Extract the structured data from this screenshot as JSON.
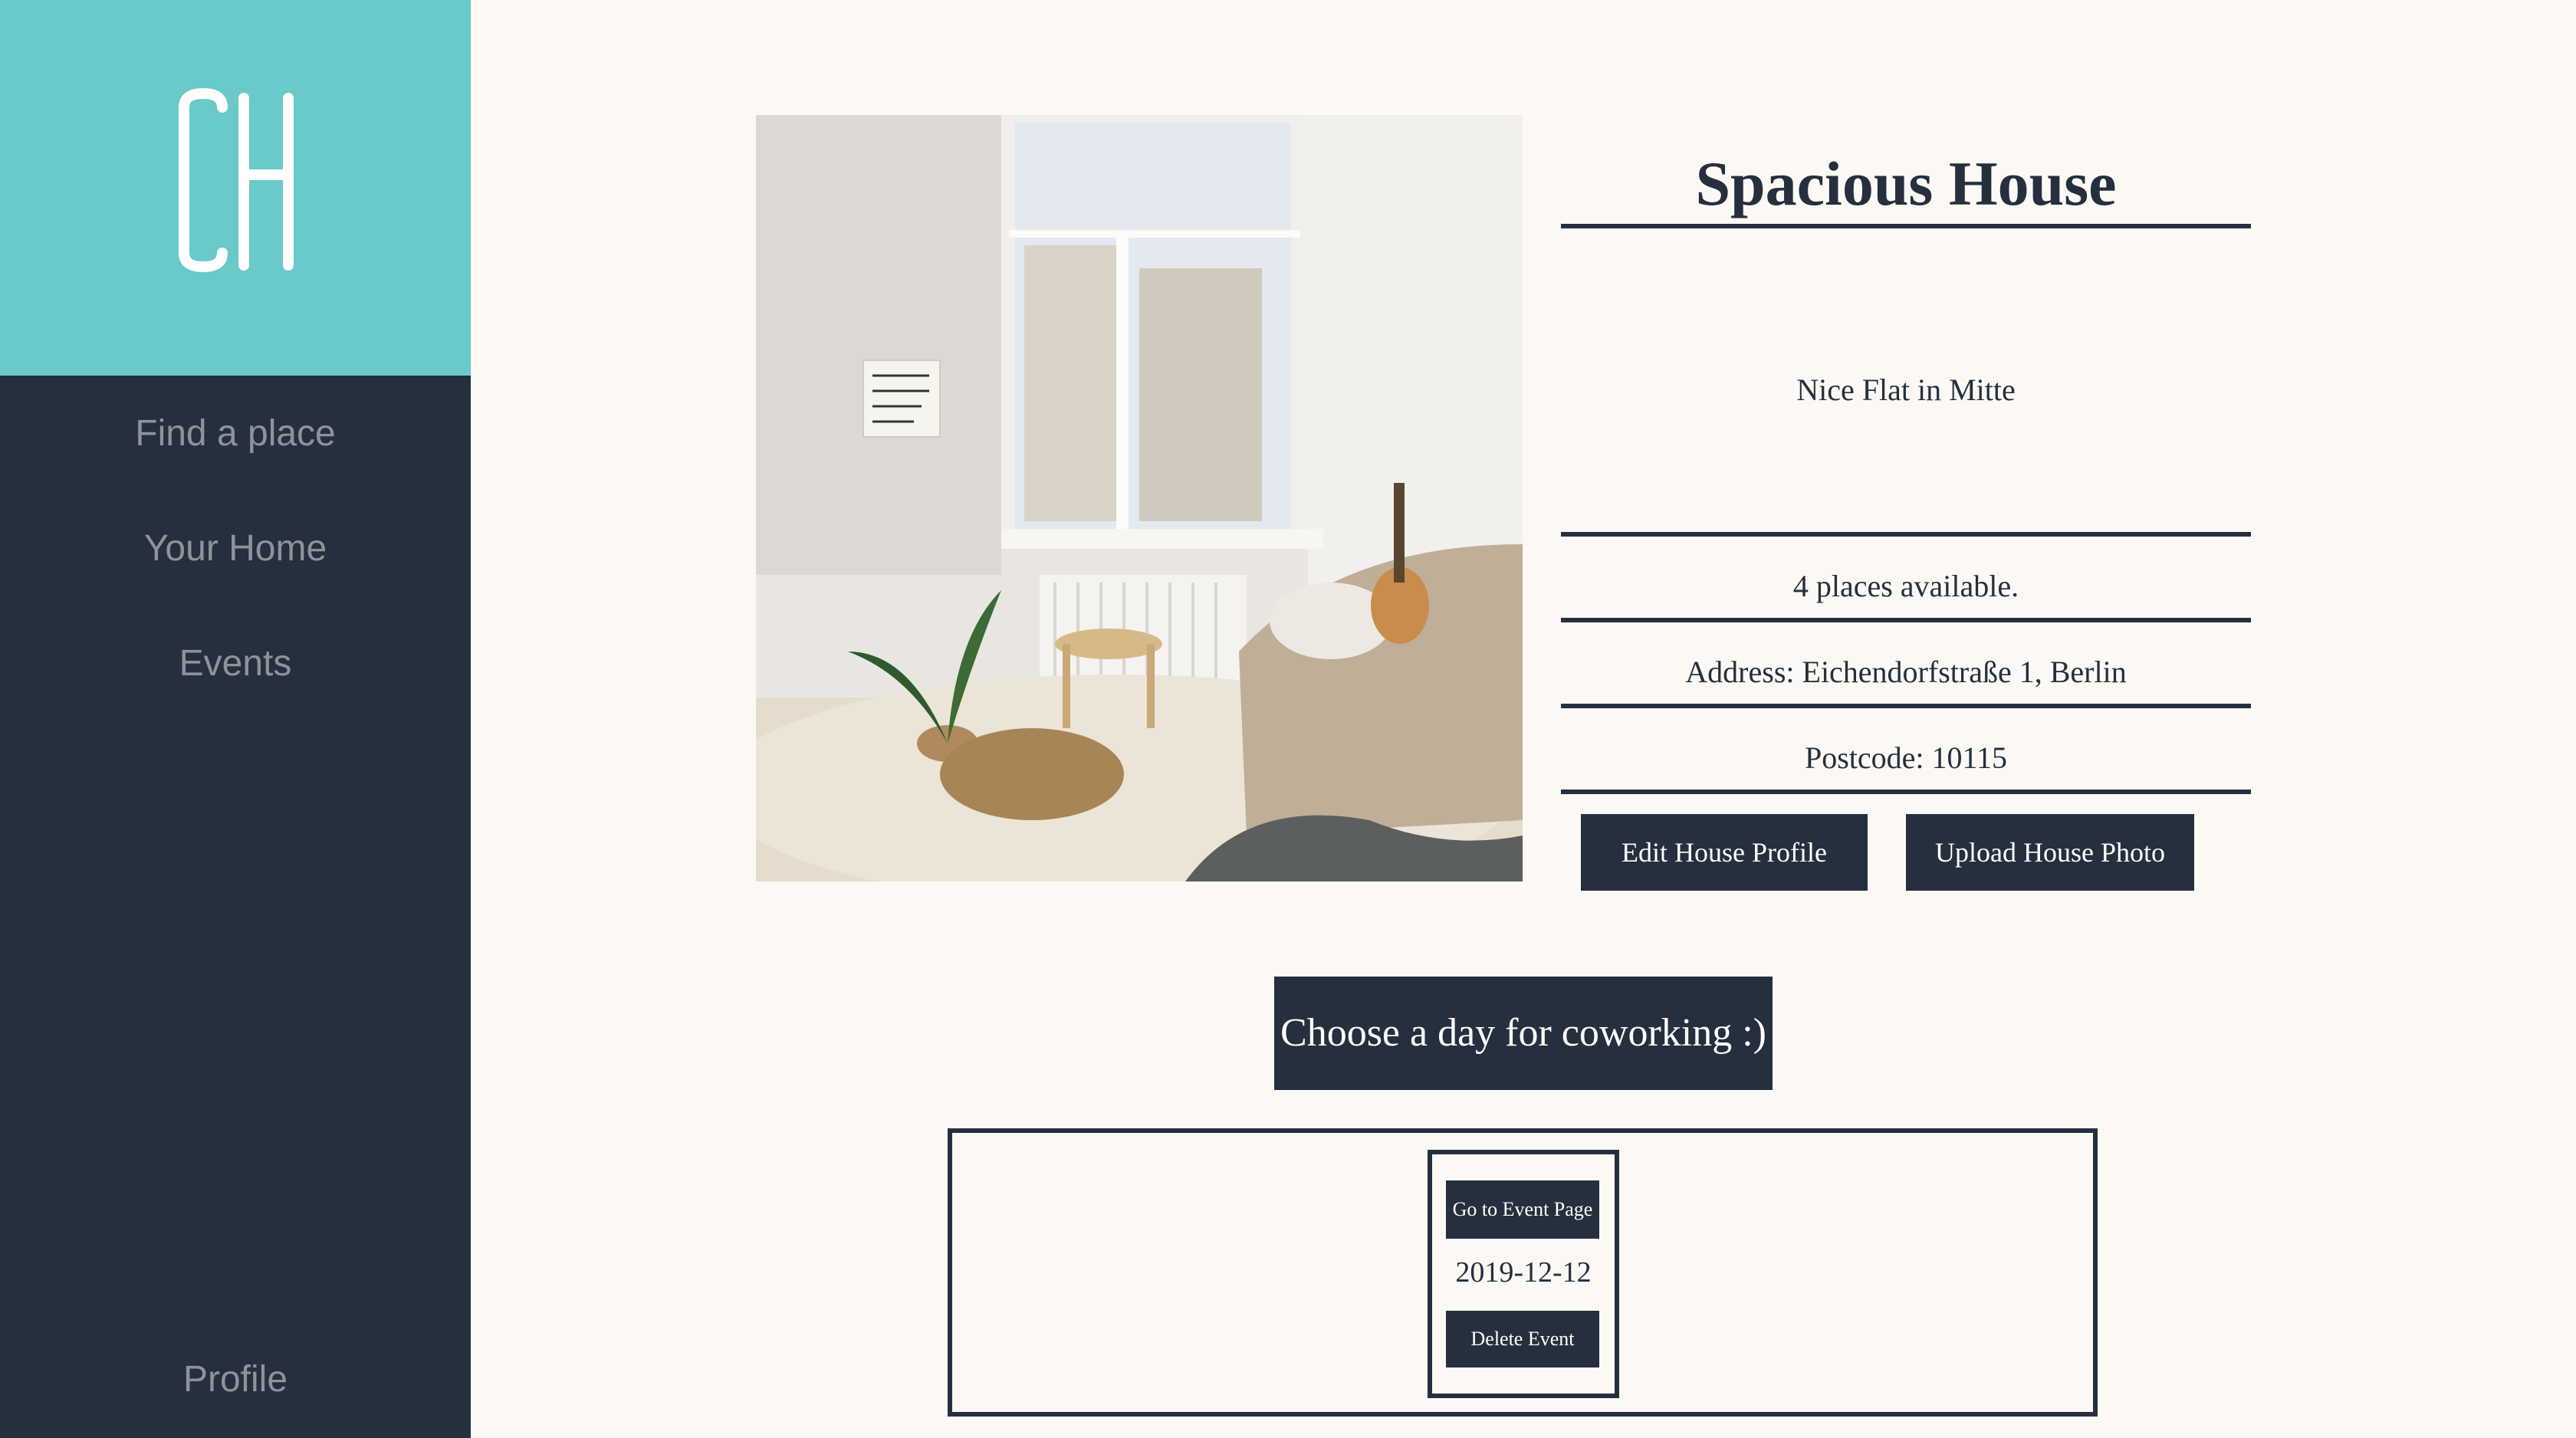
{
  "sidebar": {
    "logo_text": "CH",
    "nav": {
      "find_a_place": "Find a place",
      "your_home": "Your Home",
      "events": "Events",
      "profile": "Profile"
    }
  },
  "house": {
    "title": "Spacious House",
    "description": "Nice Flat in Mitte",
    "places": "4 places available.",
    "address": "Address: Eichendorfstraße 1, Berlin",
    "postcode": "Postcode: 10115",
    "edit_label": "Edit House Profile",
    "upload_label": "Upload House Photo"
  },
  "coworking": {
    "choose_label": "Choose a day for coworking :)"
  },
  "events": {
    "items": [
      {
        "go_label": "Go to Event Page",
        "date": "2019-12-12",
        "delete_label": "Delete Event"
      }
    ]
  },
  "colors": {
    "sidebar_bg": "#252f3e",
    "logo_bg": "#6ac9c9",
    "page_bg": "#fcf9f4",
    "accent_dark": "#252f3e",
    "nav_text": "#8e939a"
  }
}
